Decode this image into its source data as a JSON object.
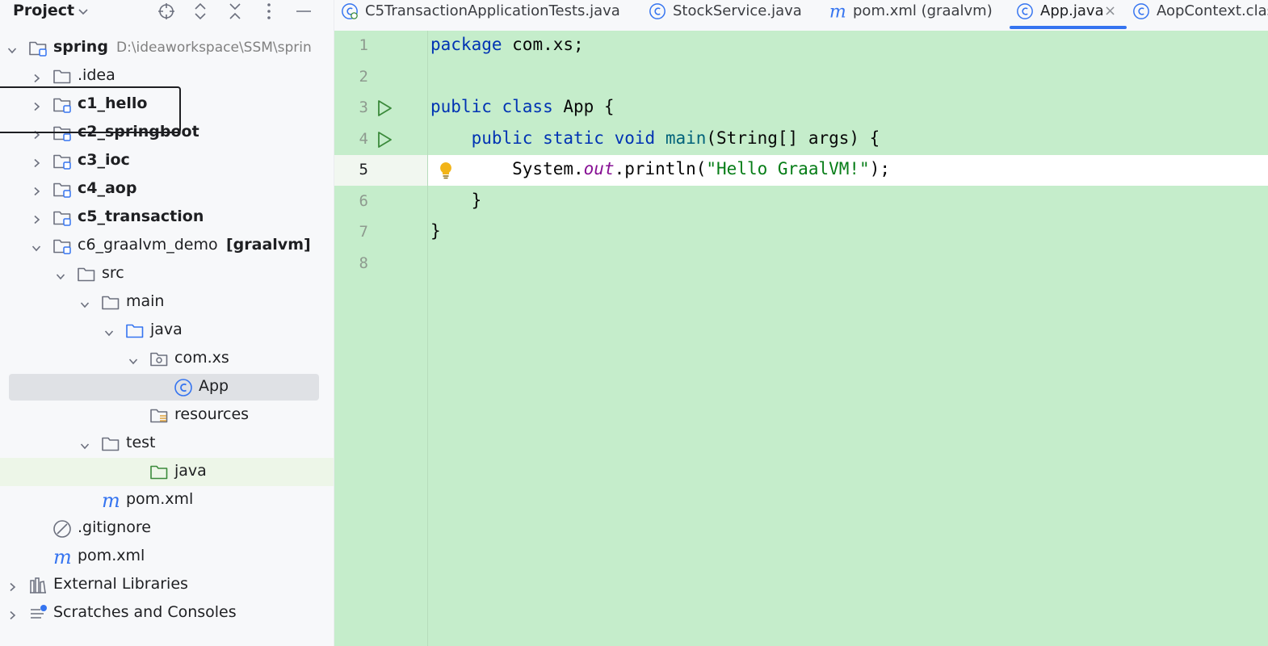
{
  "sidebar": {
    "title": "Project",
    "toolbar_icons": [
      "locate-icon",
      "expand-all-icon",
      "collapse-all-icon",
      "more-icon",
      "hide-icon"
    ],
    "tree": [
      {
        "label": "spring",
        "suffix": "D:\\ideaworkspace\\SSM\\sprin",
        "bold": true,
        "icon": "module-folder-icon",
        "expanded": true
      },
      {
        "label": ".idea",
        "bold": false,
        "icon": "folder-icon",
        "expanded": false
      },
      {
        "label": "c1_hello",
        "bold": true,
        "icon": "module-folder-icon",
        "expanded": false
      },
      {
        "label": "c2_springboot",
        "bold": true,
        "icon": "module-folder-icon",
        "expanded": false
      },
      {
        "label": "c3_ioc",
        "bold": true,
        "icon": "module-folder-icon",
        "expanded": false
      },
      {
        "label": "c4_aop",
        "bold": true,
        "icon": "module-folder-icon",
        "expanded": false
      },
      {
        "label": "c5_transaction",
        "bold": true,
        "icon": "module-folder-icon",
        "expanded": false
      },
      {
        "label": "c6_graalvm_demo",
        "suffix": "[graalvm]",
        "bold": false,
        "icon": "module-folder-icon",
        "expanded": true
      },
      {
        "label": "src",
        "icon": "folder-icon",
        "expanded": true
      },
      {
        "label": "main",
        "icon": "folder-icon",
        "expanded": true
      },
      {
        "label": "java",
        "icon": "source-folder-icon",
        "expanded": true
      },
      {
        "label": "com.xs",
        "icon": "package-icon",
        "expanded": true
      },
      {
        "label": "App",
        "icon": "java-class-icon",
        "selected": true
      },
      {
        "label": "resources",
        "icon": "resources-folder-icon"
      },
      {
        "label": "test",
        "icon": "folder-icon",
        "expanded": true
      },
      {
        "label": "java",
        "icon": "test-source-folder-icon"
      },
      {
        "label": "pom.xml",
        "icon": "maven-icon"
      },
      {
        "label": ".gitignore",
        "icon": "ignored-file-icon"
      },
      {
        "label": "pom.xml",
        "icon": "maven-icon"
      },
      {
        "label": "External Libraries",
        "icon": "libraries-icon",
        "expanded": false
      },
      {
        "label": "Scratches and Consoles",
        "icon": "scratches-icon",
        "expanded": false
      }
    ]
  },
  "tabs": [
    {
      "label": "C5TransactionApplicationTests.java",
      "icon": "test-class-icon"
    },
    {
      "label": "StockService.java",
      "icon": "java-class-icon"
    },
    {
      "label": "pom.xml (graalvm)",
      "icon": "maven-icon"
    },
    {
      "label": "App.java",
      "icon": "java-class-icon",
      "active": true,
      "close": "×"
    },
    {
      "label": "AopContext.clas",
      "icon": "java-class-icon"
    }
  ],
  "editor": {
    "lines": [
      {
        "num": "1",
        "tokens": [
          [
            "kw",
            "package"
          ],
          [
            "",
            " com.xs;"
          ]
        ]
      },
      {
        "num": "2",
        "tokens": []
      },
      {
        "num": "3",
        "tokens": [
          [
            "kw",
            "public class"
          ],
          [
            "",
            " App {"
          ]
        ],
        "run": true
      },
      {
        "num": "4",
        "tokens": [
          [
            "",
            "    "
          ],
          [
            "kw",
            "public static void"
          ],
          [
            "",
            " "
          ],
          [
            "fn",
            "main"
          ],
          [
            "",
            "(String[] args) {"
          ]
        ],
        "run": true
      },
      {
        "num": "5",
        "tokens": [
          [
            "",
            "        System."
          ],
          [
            "fld",
            "out"
          ],
          [
            "",
            ".println("
          ],
          [
            "str",
            "\"Hello GraalVM!\""
          ],
          [
            "",
            ");"
          ]
        ],
        "current": true,
        "bulb": true
      },
      {
        "num": "6",
        "tokens": [
          [
            "",
            "    }"
          ]
        ]
      },
      {
        "num": "7",
        "tokens": [
          [
            "",
            "}"
          ]
        ]
      },
      {
        "num": "8",
        "tokens": []
      }
    ],
    "colors": {
      "background": "#c5edcb",
      "keyword": "#0033b3",
      "string": "#067d17",
      "field": "#871094",
      "method": "#00627a"
    }
  }
}
